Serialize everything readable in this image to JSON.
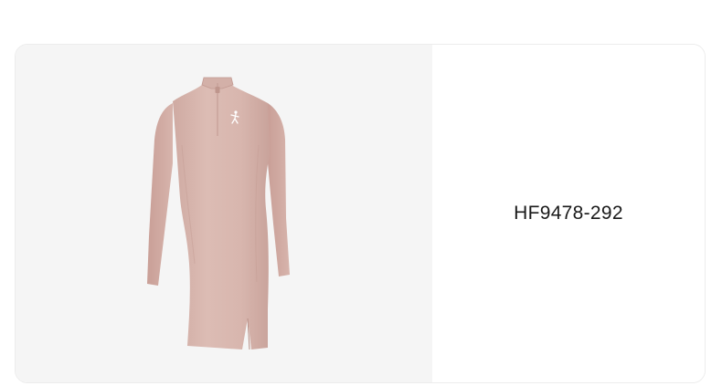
{
  "product": {
    "sku": "HF9478-292",
    "image_subject": "dress-image",
    "dress_color": "#d9b8b0",
    "panel_background": "#f5f5f5",
    "logo_icon": "jumpman-logo-icon"
  }
}
